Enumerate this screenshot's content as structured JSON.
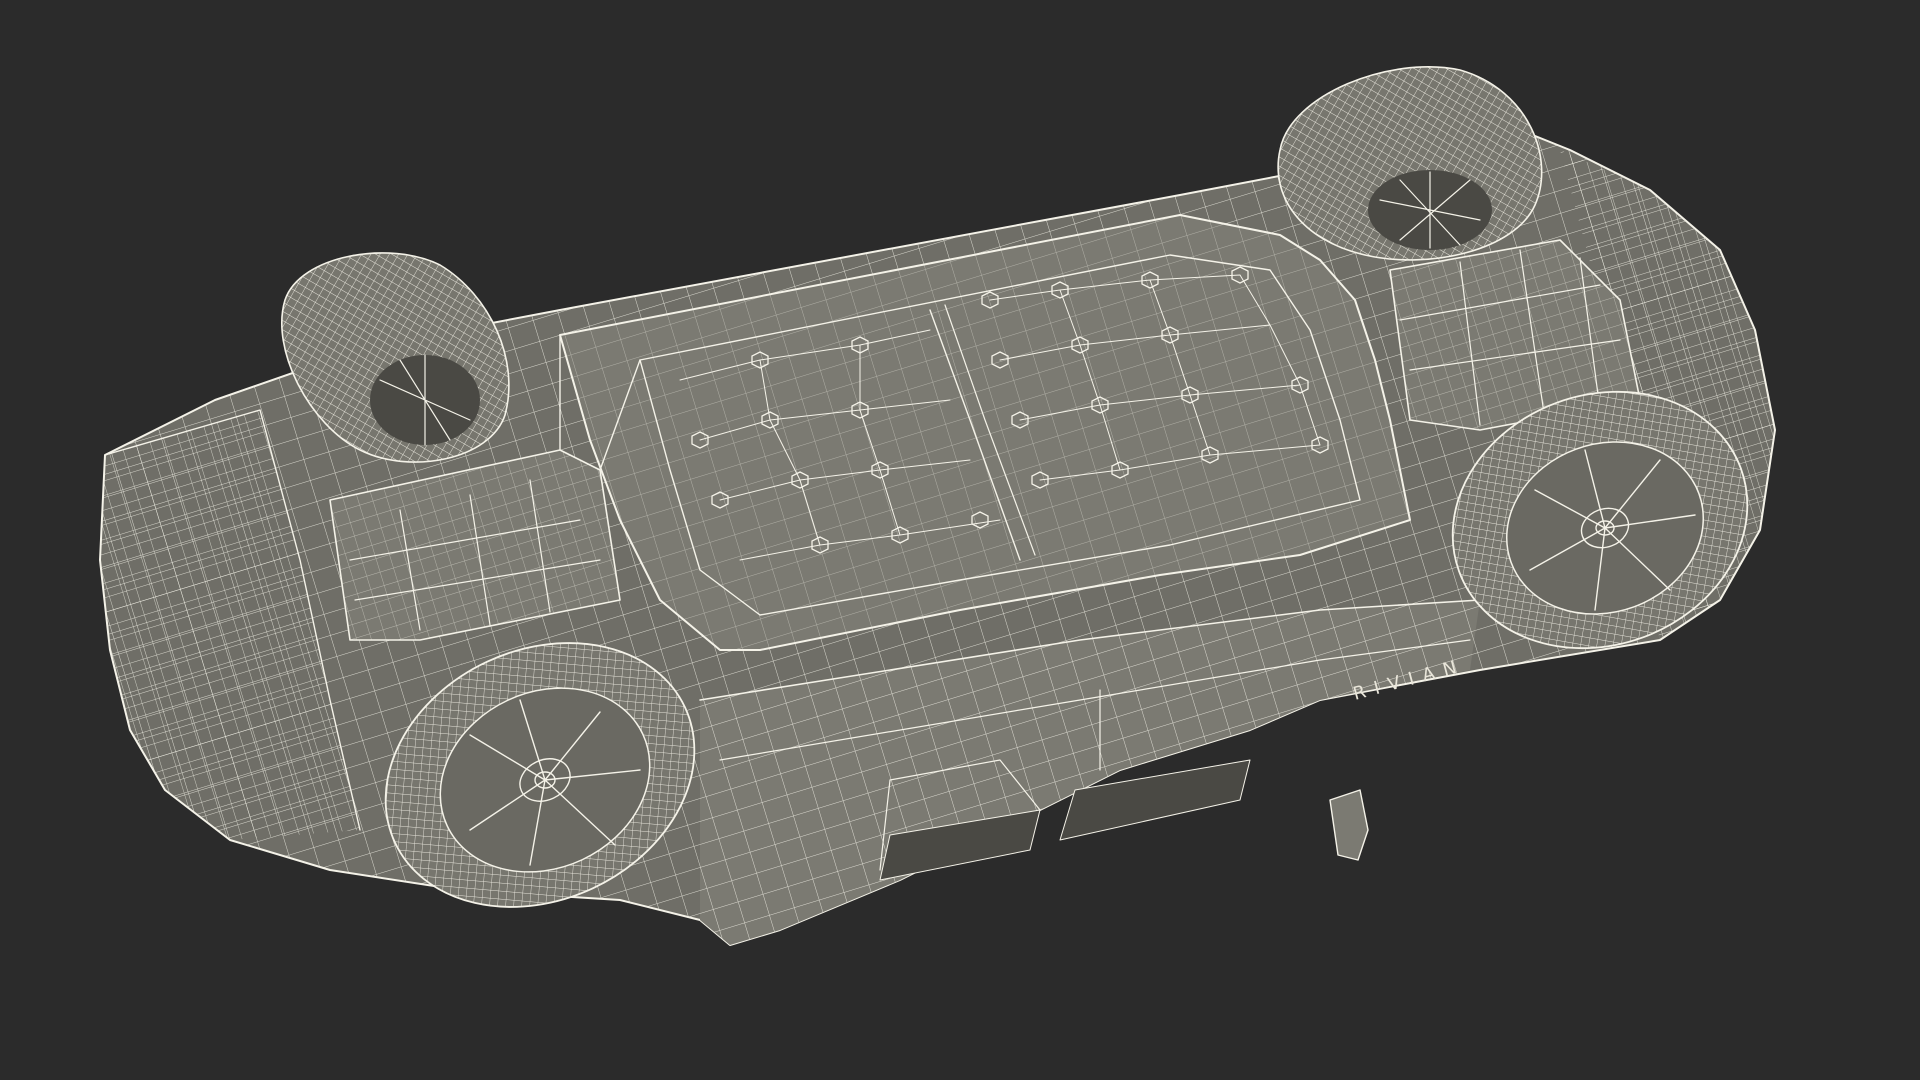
{
  "image": {
    "description_free": true,
    "background_color": "#2b2b2b",
    "wire_color": "#f4f2e8",
    "body_color": "#6f6e67"
  },
  "vehicle": {
    "brand_text": "RIVIAN"
  }
}
